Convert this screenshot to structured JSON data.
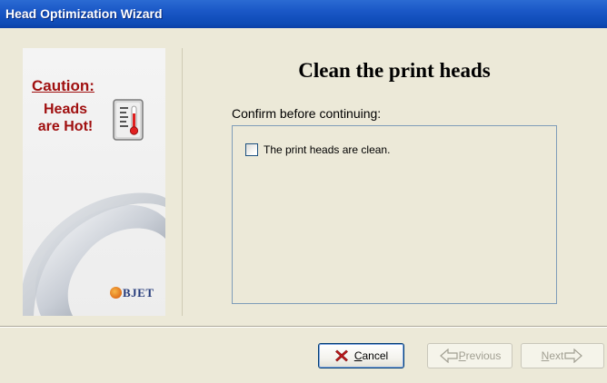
{
  "window": {
    "title": "Head Optimization Wizard"
  },
  "side_panel": {
    "caution_title": "Caution:",
    "caution_line1": "Heads",
    "caution_line2": "are Hot!",
    "logo_text": "BJET"
  },
  "main": {
    "heading": "Clean the print heads",
    "confirm_label": "Confirm before continuing:",
    "checkbox_label": "The print heads are clean.",
    "checkbox_checked": false
  },
  "buttons": {
    "cancel": {
      "mnemonic": "C",
      "rest": "ancel"
    },
    "previous": {
      "mnemonic": "P",
      "rest": "revious"
    },
    "next": {
      "mnemonic": "N",
      "rest": "ext"
    }
  },
  "colors": {
    "title_bar": "#0d4ab5",
    "caution_red": "#a01010",
    "dialog_bg": "#ece9d8",
    "cancel_icon": "#c0181c"
  },
  "icons": {
    "thermometer": "thermometer-icon",
    "cancel": "red-x-icon",
    "previous": "arrow-left-icon",
    "next": "arrow-right-icon"
  }
}
